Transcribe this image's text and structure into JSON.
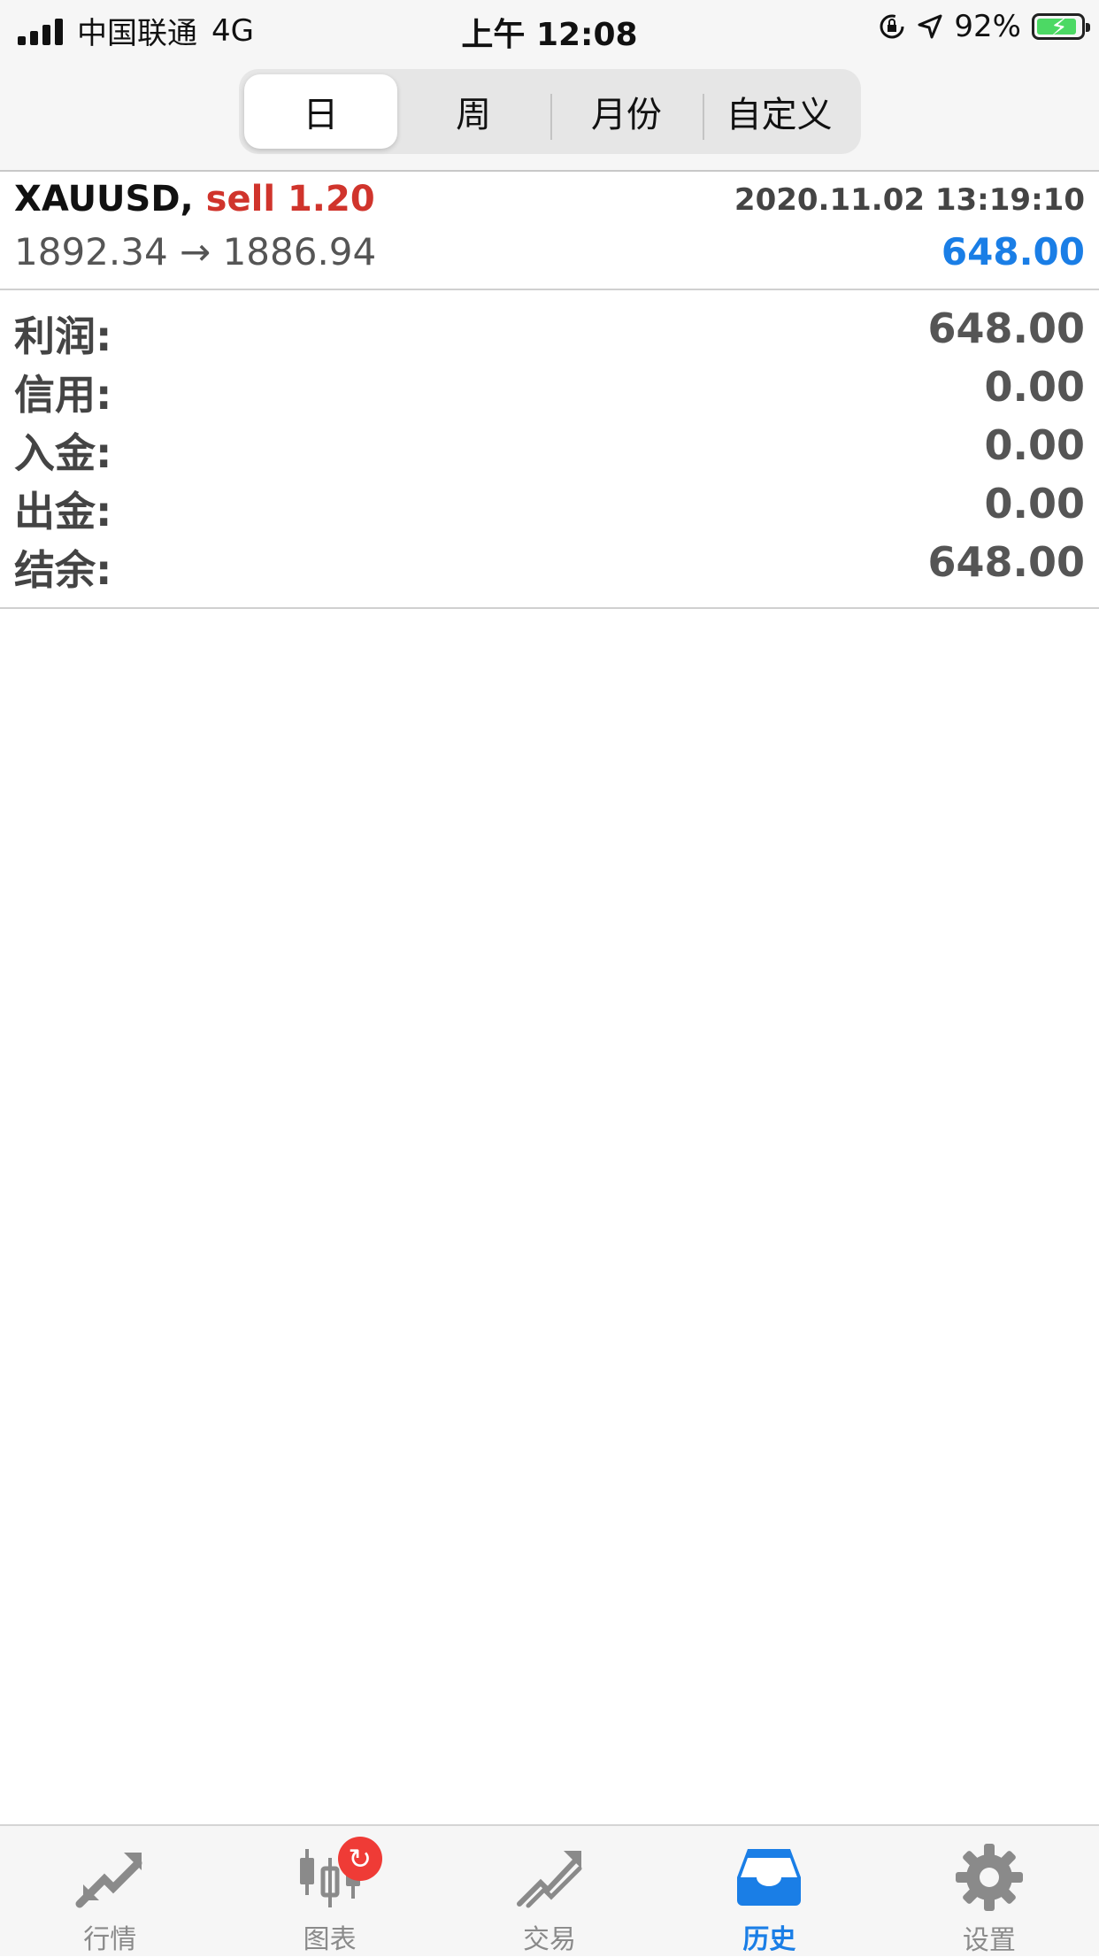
{
  "status_bar": {
    "carrier": "中国联通",
    "network": "4G",
    "time": "上午 12:08",
    "battery": "92%",
    "battery_level": 0.92
  },
  "period_tabs": [
    {
      "label": "日",
      "active": true
    },
    {
      "label": "周",
      "active": false
    },
    {
      "label": "月份",
      "active": false
    },
    {
      "label": "自定义",
      "active": false
    }
  ],
  "trade": {
    "symbol": "XAUUSD,",
    "type": "sell 1.20",
    "datetime": "2020.11.02 13:19:10",
    "prices": "1892.34 → 1886.94",
    "profit": "648.00"
  },
  "summary": [
    {
      "label": "利润:",
      "value": "648.00"
    },
    {
      "label": "信用:",
      "value": "0.00"
    },
    {
      "label": "入金:",
      "value": "0.00"
    },
    {
      "label": "出金:",
      "value": "0.00"
    },
    {
      "label": "结余:",
      "value": "648.00"
    }
  ],
  "tab_bar": [
    {
      "label": "行情",
      "icon": "quotes-arrows-icon",
      "active": false
    },
    {
      "label": "图表",
      "icon": "candlestick-chart-icon",
      "active": false,
      "badge": "↻"
    },
    {
      "label": "交易",
      "icon": "trade-trend-icon",
      "active": false
    },
    {
      "label": "历史",
      "icon": "history-inbox-icon",
      "active": true
    },
    {
      "label": "设置",
      "icon": "gear-icon",
      "active": false
    }
  ],
  "colors": {
    "accent": "#1a7ee6",
    "sell": "#d0342c",
    "badge": "#ef3b36",
    "battery": "#4cd964"
  }
}
